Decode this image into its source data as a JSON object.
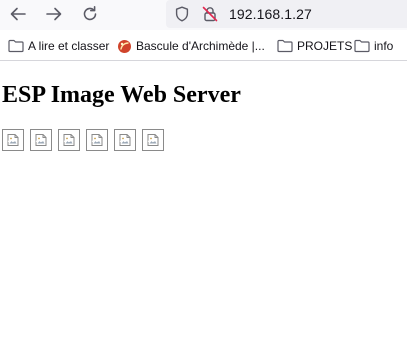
{
  "browser": {
    "url": "192.168.1.27",
    "nav": {
      "back_icon": "back-arrow-icon",
      "forward_icon": "forward-arrow-icon",
      "reload_icon": "reload-icon"
    },
    "url_icons": [
      "tracking-protection-shield-icon",
      "insecure-connection-lock-icon"
    ]
  },
  "bookmarks": [
    {
      "label": "A lire et classer",
      "icon": "folder-icon"
    },
    {
      "label": "Bascule d'Archimède |...",
      "icon": "site-favicon"
    },
    {
      "label": "PROJETS",
      "icon": "folder-icon"
    },
    {
      "label": "info",
      "icon": "folder-icon"
    }
  ],
  "page": {
    "heading": "ESP Image Web Server",
    "image_count": 6,
    "image_state": "broken-image-icon"
  },
  "colors": {
    "toolbar_bg": "#f9f9fb",
    "urlbar_bg": "#f0f0f4",
    "text": "#15141a",
    "insecure_red": "#e22850",
    "favicon_red": "#d0442b"
  }
}
